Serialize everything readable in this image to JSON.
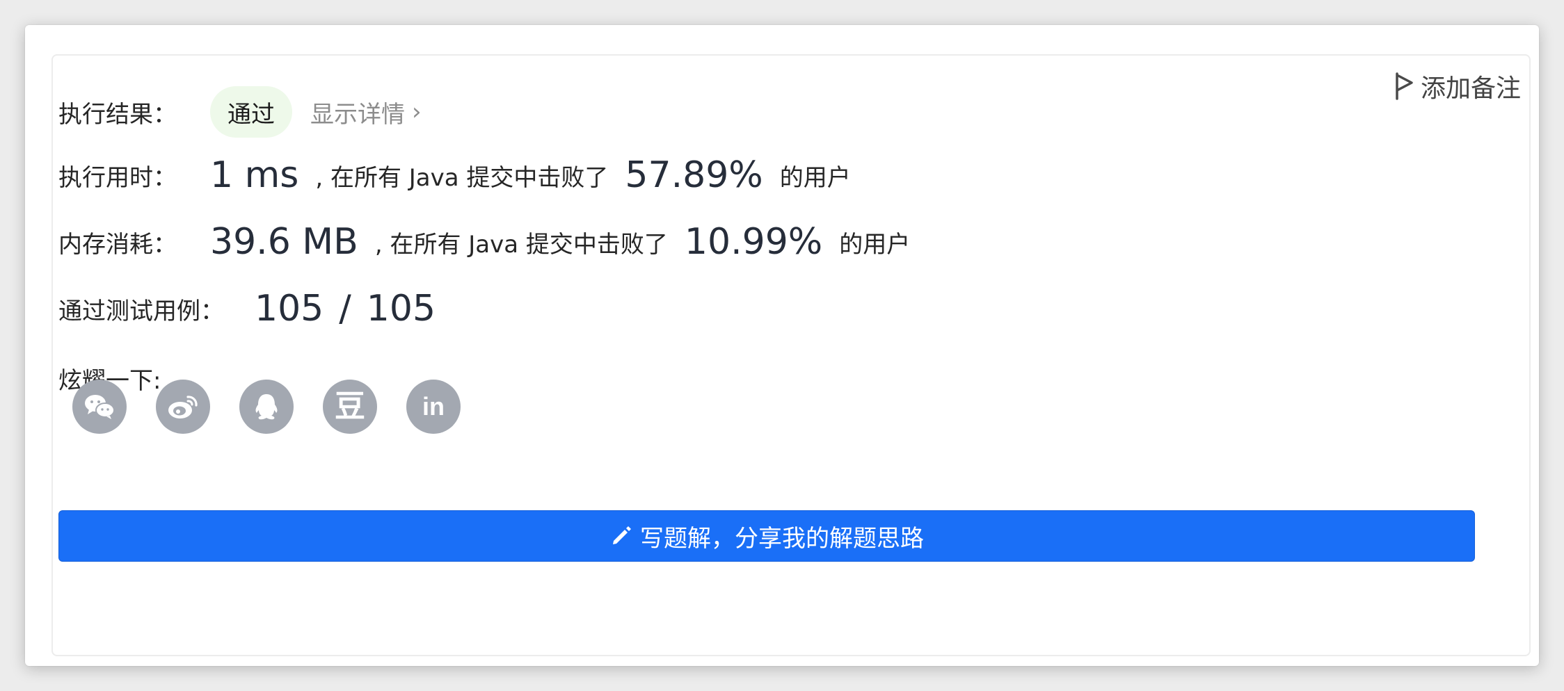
{
  "result": {
    "label": "执行结果：",
    "status": "通过",
    "details_link": "显示详情",
    "chevron": "›"
  },
  "note": {
    "label": "添加备注",
    "icon": "flag-icon"
  },
  "runtime": {
    "label": "执行用时：",
    "value": "1 ms",
    "middle_text": ", 在所有 Java 提交中击败了",
    "percent": "57.89%",
    "suffix": "的用户"
  },
  "memory": {
    "label": "内存消耗：",
    "value": "39.6 MB",
    "middle_text": ", 在所有 Java 提交中击败了",
    "percent": "10.99%",
    "suffix": "的用户"
  },
  "testcases": {
    "label": "通过测试用例：",
    "passed": "105",
    "separator": "/",
    "total": "105"
  },
  "share": {
    "label": "炫耀一下:",
    "icons": [
      "wechat-icon",
      "weibo-icon",
      "qq-icon",
      "douban-icon",
      "linkedin-icon"
    ],
    "douban_glyph": "豆",
    "linkedin_glyph": "in"
  },
  "write_solution": {
    "label": "写题解，分享我的解题思路",
    "icon": "pencil-icon"
  },
  "colors": {
    "accent": "#1a6ff7",
    "pass_bg": "#eef9ea",
    "icon_bg": "#a3a8b1",
    "muted_text": "#8c8c8c"
  }
}
